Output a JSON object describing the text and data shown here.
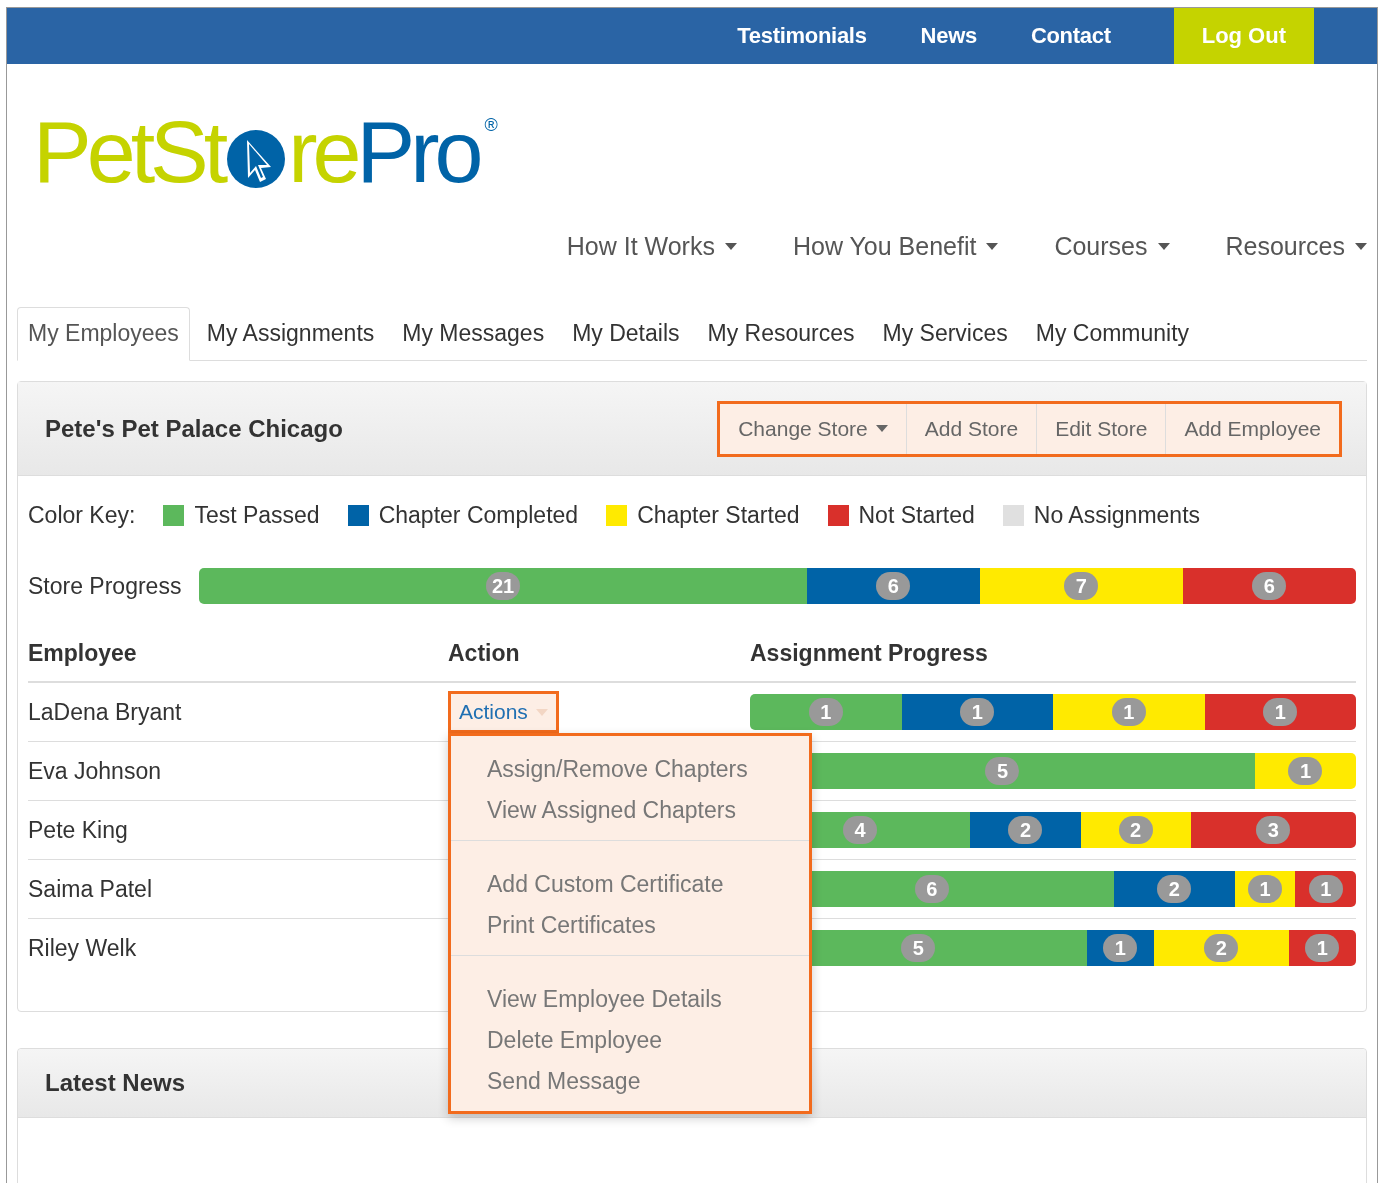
{
  "top_nav": {
    "links": [
      "Testimonials",
      "News",
      "Contact"
    ],
    "logout": "Log Out"
  },
  "logo": {
    "text_1": "PetSt",
    "text_2": "re",
    "text_3": "Pro",
    "mark": "®"
  },
  "main_nav": [
    "How It Works",
    "How You Benefit",
    "Courses",
    "Resources"
  ],
  "tabs": [
    {
      "label": "My Employees",
      "selected": true
    },
    {
      "label": "My Assignments",
      "selected": false
    },
    {
      "label": "My Messages",
      "selected": false
    },
    {
      "label": "My Details",
      "selected": false
    },
    {
      "label": "My Resources",
      "selected": false
    },
    {
      "label": "My Services",
      "selected": false
    },
    {
      "label": "My Community",
      "selected": false
    }
  ],
  "store_panel": {
    "title": "Pete's Pet Palace Chicago",
    "buttons": [
      {
        "label": "Change Store",
        "kind": "dropdown"
      },
      {
        "label": "Add Store",
        "kind": "plain"
      },
      {
        "label": "Edit Store",
        "kind": "plain"
      },
      {
        "label": "Add Employee",
        "kind": "plain"
      }
    ],
    "color_key": {
      "label": "Color Key:",
      "items": [
        {
          "label": "Test Passed",
          "color": "#5cb85c"
        },
        {
          "label": "Chapter Completed",
          "color": "#0063a7"
        },
        {
          "label": "Chapter Started",
          "color": "#ffea00"
        },
        {
          "label": "Not Started",
          "color": "#d9302b"
        },
        {
          "label": "No Assignments",
          "color": "#e0e0e0"
        }
      ]
    },
    "store_progress": {
      "label": "Store Progress",
      "segments": [
        {
          "count": "21",
          "color": "#5cb85c"
        },
        {
          "count": "6",
          "color": "#0063a7"
        },
        {
          "count": "7",
          "color": "#ffea00"
        },
        {
          "count": "6",
          "color": "#d9302b"
        }
      ]
    },
    "columns": [
      "Employee",
      "Action",
      "Assignment Progress"
    ],
    "rows": [
      {
        "name": "LaDena Bryant",
        "action": {
          "label": "Actions",
          "expanded": true,
          "menu": [
            [
              "Assign/Remove Chapters",
              "View Assigned Chapters"
            ],
            [
              "Add Custom Certificate",
              "Print Certificates"
            ],
            [
              "View Employee Details",
              "Delete Employee",
              "Send Message"
            ]
          ]
        },
        "segments": [
          {
            "count": "1",
            "color": "#5cb85c"
          },
          {
            "count": "1",
            "color": "#0063a7"
          },
          {
            "count": "1",
            "color": "#ffea00"
          },
          {
            "count": "1",
            "color": "#d9302b"
          }
        ]
      },
      {
        "name": "Eva Johnson",
        "segments": [
          {
            "count": "5",
            "color": "#5cb85c"
          },
          {
            "count": "1",
            "color": "#ffea00"
          }
        ]
      },
      {
        "name": "Pete King",
        "segments": [
          {
            "count": "4",
            "color": "#5cb85c"
          },
          {
            "count": "2",
            "color": "#0063a7"
          },
          {
            "count": "2",
            "color": "#ffea00"
          },
          {
            "count": "3",
            "color": "#d9302b"
          }
        ]
      },
      {
        "name": "Saima Patel",
        "segments": [
          {
            "count": "6",
            "color": "#5cb85c"
          },
          {
            "count": "2",
            "color": "#0063a7"
          },
          {
            "count": "1",
            "color": "#ffea00"
          },
          {
            "count": "1",
            "color": "#d9302b"
          }
        ]
      },
      {
        "name": "Riley Welk",
        "segments": [
          {
            "count": "5",
            "color": "#5cb85c"
          },
          {
            "count": "1",
            "color": "#0063a7"
          },
          {
            "count": "2",
            "color": "#ffea00"
          },
          {
            "count": "1",
            "color": "#d9302b"
          }
        ]
      }
    ]
  },
  "news_panel": {
    "title": "Latest News"
  }
}
